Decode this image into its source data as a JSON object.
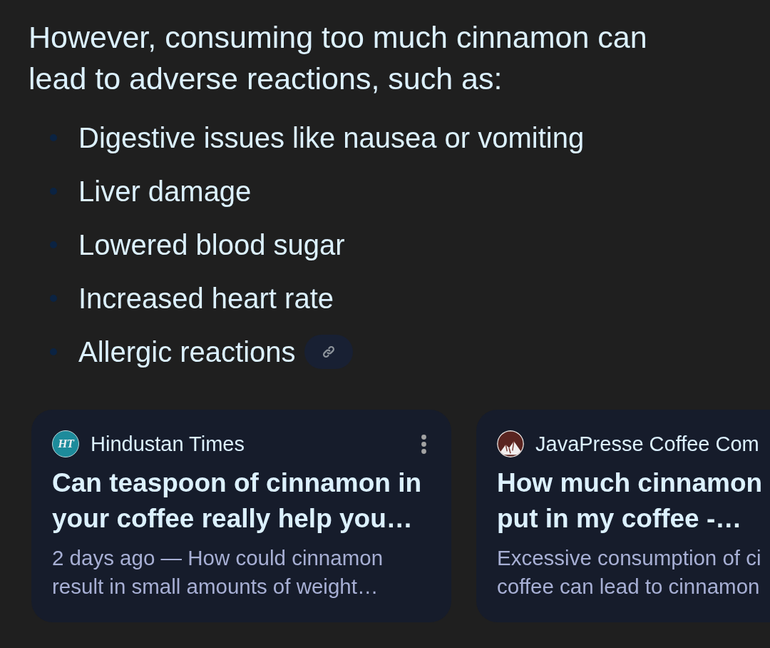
{
  "answer": {
    "intro": "However, consuming too much cinnamon can lead to adverse reactions, such as:",
    "bullets": [
      {
        "text": "Digestive issues like nausea or vomiting",
        "link": false
      },
      {
        "text": "Liver damage",
        "link": false
      },
      {
        "text": "Lowered blood sugar",
        "link": false
      },
      {
        "text": "Increased heart rate",
        "link": false
      },
      {
        "text": "Allergic reactions",
        "link": true
      }
    ]
  },
  "sources": [
    {
      "logo": {
        "kind": "monogram",
        "text": "HT"
      },
      "source": "Hindustan Times",
      "menu": true,
      "title": "Can teaspoon of cinnamon in\nyour coffee really help you…",
      "snippet": "2 days ago — How could cinnamon\nresult in small amounts of weight…"
    },
    {
      "logo": {
        "kind": "mountain"
      },
      "source": "JavaPresse Coffee Com",
      "title": "How much cinnamon\nput in my coffee -…",
      "snippet": "Excessive consumption of ci\ncoffee can lead to cinnamon"
    }
  ]
}
